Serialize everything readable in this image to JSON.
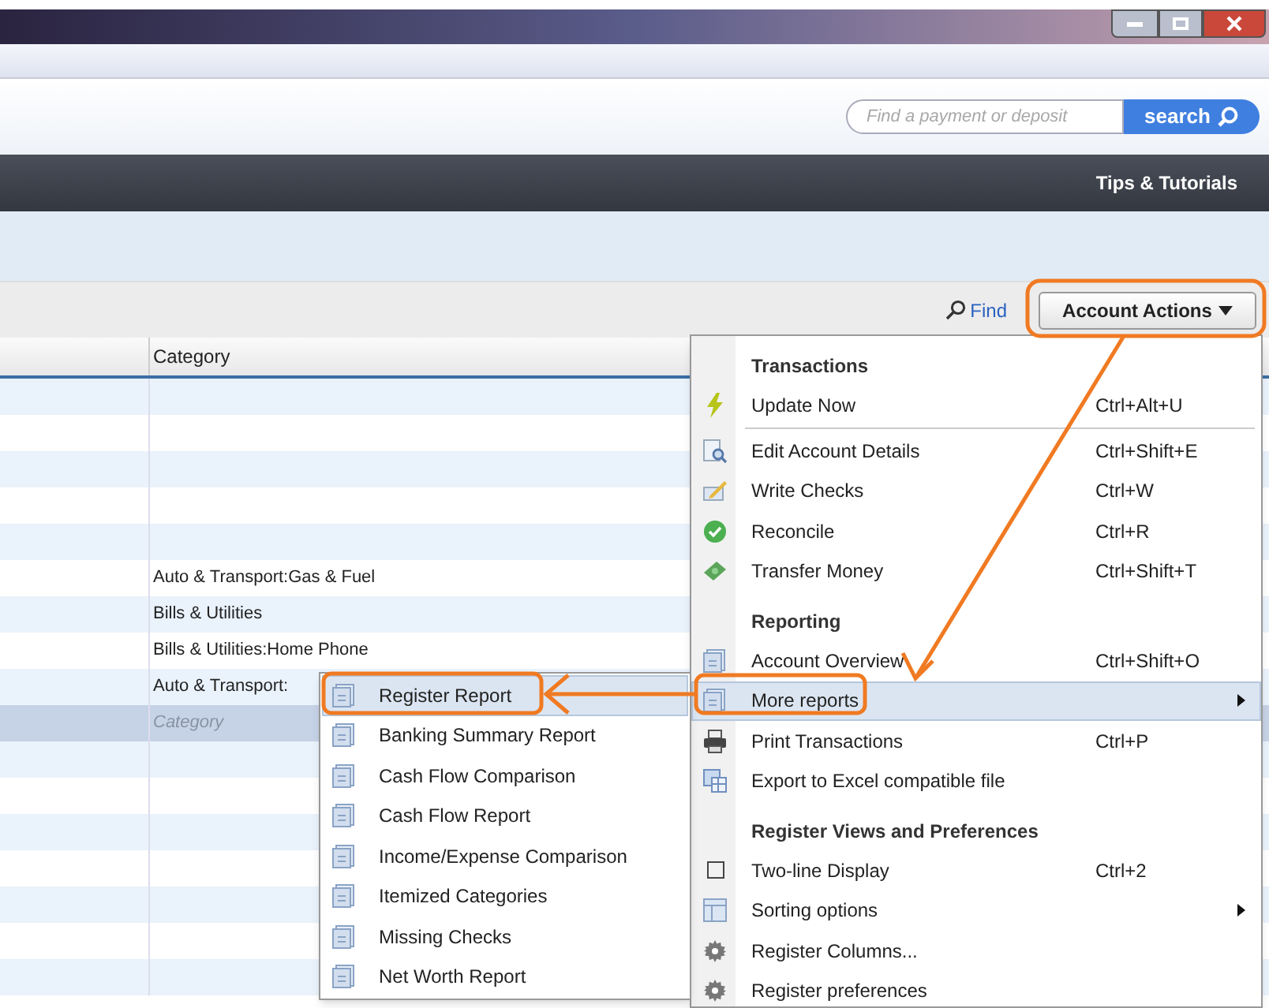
{
  "search": {
    "placeholder": "Find a payment or deposit",
    "button": "search"
  },
  "nav": {
    "tips": "Tips & Tutorials"
  },
  "toolbar": {
    "find": "Find",
    "account_actions": "Account Actions"
  },
  "table": {
    "columns": [
      {
        "label": "Category"
      }
    ],
    "rows": [
      {
        "selected": false
      },
      {
        "selected": false
      },
      {
        "selected": false
      },
      {
        "selected": false
      },
      {
        "selected": false
      },
      {
        "category": "Auto & Transport:Gas & Fuel",
        "selected": false
      },
      {
        "category": "Bills & Utilities",
        "selected": false
      },
      {
        "category": "Bills & Utilities:Home Phone",
        "selected": false
      },
      {
        "category": "Auto & Transport:",
        "selected": false
      },
      {
        "placeholder": "Category",
        "selected": true
      },
      {
        "selected": false
      },
      {
        "selected": false
      },
      {
        "selected": false
      },
      {
        "selected": false
      },
      {
        "selected": false
      },
      {
        "selected": false
      },
      {
        "selected": false
      }
    ]
  },
  "menu": {
    "items": [
      {
        "kind": "header",
        "label": "Transactions"
      },
      {
        "kind": "item",
        "label": "Update Now",
        "shortcut": "Ctrl+Alt+U",
        "selected": false
      },
      {
        "kind": "separator"
      },
      {
        "kind": "item",
        "label": "Edit Account Details",
        "shortcut": "Ctrl+Shift+E",
        "selected": false
      },
      {
        "kind": "item",
        "label": "Write Checks",
        "shortcut": "Ctrl+W",
        "selected": false
      },
      {
        "kind": "item",
        "label": "Reconcile",
        "shortcut": "Ctrl+R",
        "selected": false
      },
      {
        "kind": "item",
        "label": "Transfer Money",
        "shortcut": "Ctrl+Shift+T",
        "selected": false
      },
      {
        "kind": "header",
        "label": "Reporting"
      },
      {
        "kind": "item",
        "label": "Account Overview",
        "shortcut": "Ctrl+Shift+O",
        "selected": false
      },
      {
        "kind": "item",
        "label": "More reports",
        "submenu": true,
        "selected": true
      },
      {
        "kind": "item",
        "label": "Print Transactions",
        "shortcut": "Ctrl+P",
        "selected": false
      },
      {
        "kind": "item",
        "label": "Export to Excel compatible file",
        "selected": false
      },
      {
        "kind": "header",
        "label": "Register Views and Preferences"
      },
      {
        "kind": "check",
        "label": "Two-line Display",
        "shortcut": "Ctrl+2",
        "checked": false,
        "selected": false
      },
      {
        "kind": "item",
        "label": "Sorting options",
        "submenu": true,
        "selected": false
      },
      {
        "kind": "item",
        "label": "Register Columns...",
        "selected": false
      },
      {
        "kind": "item",
        "label": "Register preferences",
        "selected": false
      }
    ]
  },
  "submenu": {
    "items": [
      {
        "label": "Register Report",
        "selected": true
      },
      {
        "label": "Banking Summary Report",
        "selected": false
      },
      {
        "label": "Cash Flow Comparison",
        "selected": false
      },
      {
        "label": "Cash Flow Report",
        "selected": false
      },
      {
        "label": "Income/Expense Comparison",
        "selected": false
      },
      {
        "label": "Itemized Categories",
        "selected": false
      },
      {
        "label": "Missing Checks",
        "selected": false
      },
      {
        "label": "Net Worth Report",
        "selected": false
      }
    ]
  }
}
